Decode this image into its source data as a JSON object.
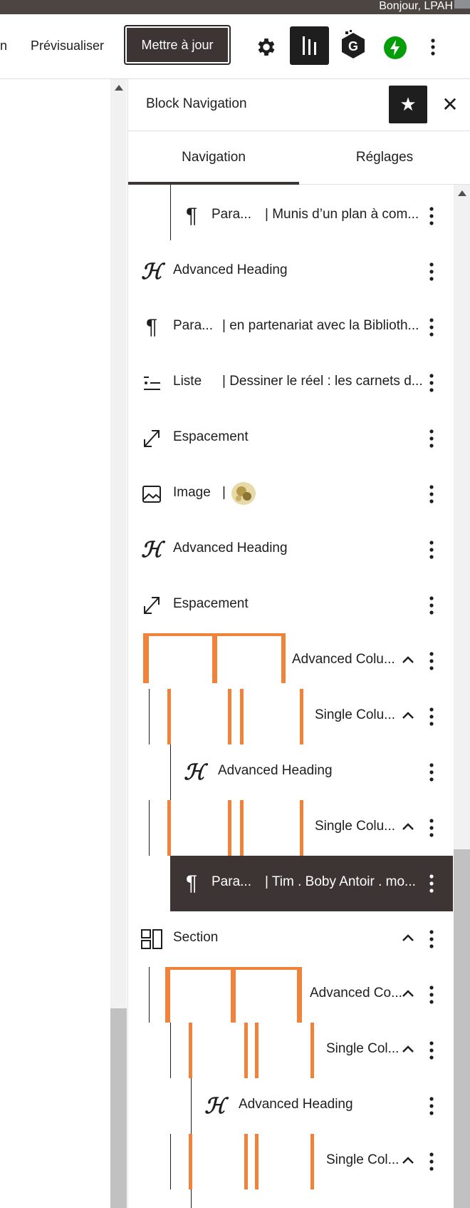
{
  "admin_bar": {
    "greeting": "Bonjour, LPAH"
  },
  "toolbar": {
    "cut_label": "n",
    "preview_label": "Prévisualiser",
    "update_label": "Mettre à jour",
    "icons": [
      "gear-icon",
      "list-view-icon",
      "g-plugin-icon",
      "jetpack-icon",
      "more-icon"
    ]
  },
  "panel": {
    "title": "Block Navigation",
    "tabs": [
      {
        "label": "Navigation",
        "active": true
      },
      {
        "label": "Réglages",
        "active": false
      }
    ]
  },
  "blocks": [
    {
      "type": "Para...",
      "detail": "| Munis d’un plan à com...",
      "icon": "paragraph-icon"
    },
    {
      "type": "Advanced Heading",
      "detail": "",
      "icon": "heading-icon"
    },
    {
      "type": "Para...",
      "detail": "| en partenariat avec la Biblioth...",
      "icon": "paragraph-icon"
    },
    {
      "type": "Liste",
      "detail": "| Dessiner le réel : les carnets d...",
      "icon": "list-icon"
    },
    {
      "type": "Espacement",
      "detail": "",
      "icon": "spacer-icon"
    },
    {
      "type": "Image",
      "detail": "|",
      "icon": "image-icon"
    },
    {
      "type": "Advanced Heading",
      "detail": "",
      "icon": "heading-icon"
    },
    {
      "type": "Espacement",
      "detail": "",
      "icon": "spacer-icon"
    },
    {
      "type": "Advanced Colu...",
      "detail": "",
      "icon": "columns-icon"
    },
    {
      "type": "Single Colu...",
      "detail": "",
      "icon": "column-icon"
    },
    {
      "type": "Advanced Heading",
      "detail": "",
      "icon": "heading-icon"
    },
    {
      "type": "Single Colu...",
      "detail": "",
      "icon": "column-icon"
    },
    {
      "type": "Para...",
      "detail": "| Tim . Boby Antoir . mo...",
      "icon": "paragraph-icon",
      "selected": true
    },
    {
      "type": "Section",
      "detail": "",
      "icon": "section-icon"
    },
    {
      "type": "Advanced Co...",
      "detail": "",
      "icon": "columns-icon"
    },
    {
      "type": "Single Col...",
      "detail": "",
      "icon": "column-icon"
    },
    {
      "type": "Advanced Heading",
      "detail": "",
      "icon": "heading-icon"
    },
    {
      "type": "Single Col...",
      "detail": "",
      "icon": "column-icon"
    }
  ],
  "colors": {
    "accent": "#f0823a",
    "dark": "#3c3533",
    "admin_bar": "#4d4541",
    "jetpack": "#069e08"
  }
}
